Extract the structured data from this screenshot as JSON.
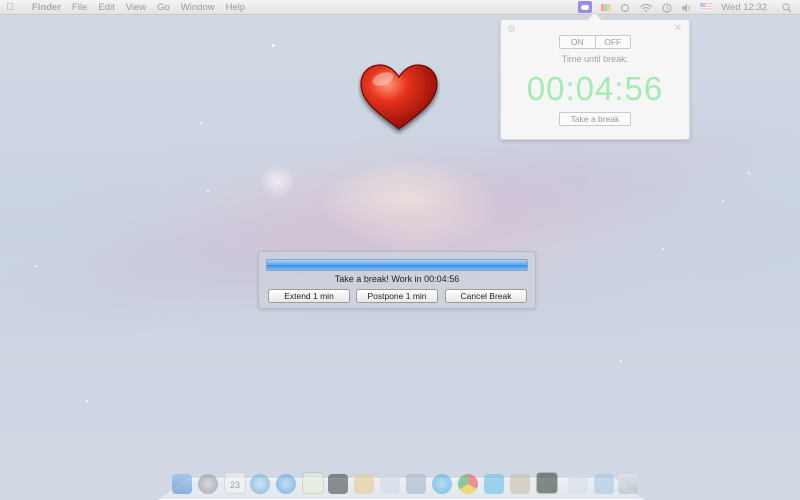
{
  "menubar": {
    "app_name": "Finder",
    "menus": [
      "File",
      "Edit",
      "View",
      "Go",
      "Window",
      "Help"
    ],
    "clock": "Wed 12:32"
  },
  "popover": {
    "toggle_on": "ON",
    "toggle_off": "OFF",
    "label": "Time until break:",
    "countdown": "00:04:56",
    "take_break_label": "Take a break",
    "accent_color": "#a3ecb1"
  },
  "dialog": {
    "message": "Take a break! Work in 00:04:56",
    "progress": 1.0,
    "buttons": {
      "extend": "Extend 1 min",
      "postpone": "Postpone 1 min",
      "cancel": "Cancel Break"
    }
  },
  "dock": {
    "calendar_day": "23",
    "icons": [
      "finder-icon",
      "launchpad-icon",
      "calendar-icon",
      "itunes-icon",
      "app-store-icon",
      "messages-icon",
      "terminal-icon",
      "package-icon",
      "preview-icon",
      "xcode-icon",
      "skype-icon",
      "chrome-icon",
      "twitter-icon",
      "photo-icon",
      "activity-monitor-icon",
      "finder-window-icon",
      "folder-icon",
      "trash-icon"
    ]
  }
}
